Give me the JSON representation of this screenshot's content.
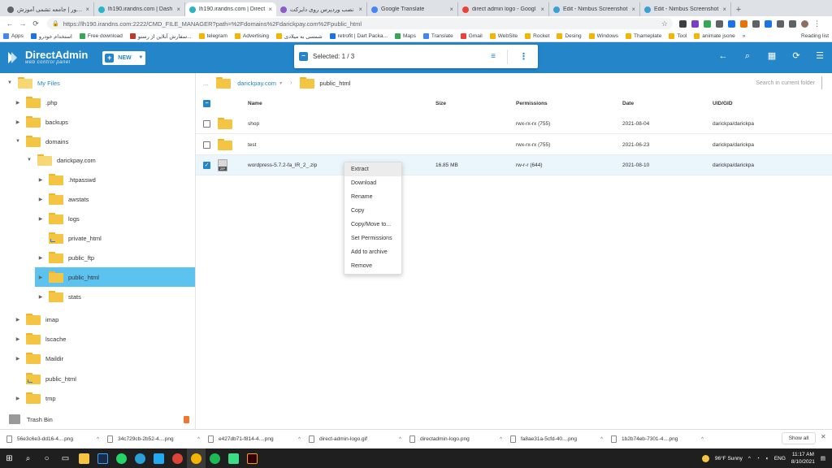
{
  "browser": {
    "tabs": [
      {
        "title": "المنتور | جامعه تشمی آموزش",
        "color": "#5f6368",
        "active": false
      },
      {
        "title": "lh190.irandns.com | Dash",
        "color": "#2bb3c6",
        "active": false
      },
      {
        "title": "lh190.irandns.com | Direct",
        "color": "#2bb3c6",
        "active": true
      },
      {
        "title": "نصب وردپرس روی دایرکت",
        "color": "#8a5cc7",
        "active": false
      },
      {
        "title": "Google Translate",
        "color": "#4285f4",
        "active": false
      },
      {
        "title": "direct admin logo - Googl",
        "color": "#ea4335",
        "active": false
      },
      {
        "title": "Edit - Nimbus Screenshot",
        "color": "#3aa0d8",
        "active": false
      },
      {
        "title": "Edit - Nimbus Screenshot",
        "color": "#3aa0d8",
        "active": false
      }
    ],
    "url": "https://lh190.irandns.com:2222/CMD_FILE_MANAGER?path=%2Fdomains%2Fdarickpay.com%2Fpublic_html",
    "bookmarks": [
      {
        "label": "Apps",
        "color": "#4285f4"
      },
      {
        "label": "استخدام خودرو",
        "color": "#1a73e8"
      },
      {
        "label": "Free download",
        "color": "#34a853"
      },
      {
        "label": "سفارش آنلاین از رستو...",
        "color": "#c0392b"
      },
      {
        "label": "telegram",
        "color": "#f4b400"
      },
      {
        "label": "Advertising",
        "color": "#f4b400"
      },
      {
        "label": "شمسی به میلادی",
        "color": "#f4b400"
      },
      {
        "label": "retrofit | Dart Packa...",
        "color": "#1a73e8"
      },
      {
        "label": "Maps",
        "color": "#34a853"
      },
      {
        "label": "Translate",
        "color": "#4285f4"
      },
      {
        "label": "Gmail",
        "color": "#ea4335"
      },
      {
        "label": "WebSite",
        "color": "#f4b400"
      },
      {
        "label": "Rocket",
        "color": "#f4b400"
      },
      {
        "label": "Desing",
        "color": "#f4b400"
      },
      {
        "label": "Windows",
        "color": "#f4b400"
      },
      {
        "label": "Thameplate",
        "color": "#f4b400"
      },
      {
        "label": "Tool",
        "color": "#f4b400"
      },
      {
        "label": "animate jsone",
        "color": "#f4b400"
      }
    ],
    "reading_list": "Reading list"
  },
  "app": {
    "logo_title": "DirectAdmin",
    "logo_sub": "web control panel",
    "new_label": "NEW",
    "selected_label": "Selected: 1 / 3",
    "accent": "#2486c8"
  },
  "sidebar": {
    "items": [
      {
        "label": "My Files",
        "icon": "folder-open-icon"
      },
      {
        "label": ".php"
      },
      {
        "label": "backups"
      },
      {
        "label": "domains"
      },
      {
        "label": "darickpay.com"
      },
      {
        "label": ".htpasswd"
      },
      {
        "label": "awstats"
      },
      {
        "label": "logs"
      },
      {
        "label": "private_html"
      },
      {
        "label": "public_ftp"
      },
      {
        "label": "public_html"
      },
      {
        "label": "stats"
      },
      {
        "label": "imap"
      },
      {
        "label": "lscache"
      },
      {
        "label": "Maildir"
      },
      {
        "label": "public_html"
      },
      {
        "label": "tmp"
      }
    ],
    "trash_label": "Trash Bin"
  },
  "breadcrumb": {
    "dots": "...",
    "domain": "darickpay.com",
    "current": "public_html",
    "search_placeholder": "Search in current folder"
  },
  "table": {
    "headers": {
      "name": "Name",
      "size": "Size",
      "permissions": "Permissions",
      "date": "Date",
      "owner": "UID/GID"
    },
    "rows": [
      {
        "name": "shop",
        "size": "",
        "permissions": "rwx-rx-rx (755)",
        "date": "2021-08-04",
        "owner": "darickpa/darickpa"
      },
      {
        "name": "test",
        "size": "",
        "permissions": "rwx-rx-rx (755)",
        "date": "2021-06-23",
        "owner": "darickpa/darickpa"
      },
      {
        "name": "wordpress-5.7.2-fa_IR_2_.zip",
        "size": "16.85 MB",
        "permissions": "rw-r-r (644)",
        "date": "2021-08-10",
        "owner": "darickpa/darickpa"
      }
    ]
  },
  "context_menu": [
    "Extract",
    "Download",
    "Rename",
    "Copy",
    "Copy/Move to...",
    "Set Permissions",
    "Add to archive",
    "Remove"
  ],
  "downloads": {
    "items": [
      "56e3c6e3-dd16-4....png",
      "34c729cb-2b52-4....png",
      "e427db71-f814-4....png",
      "direct-admin-logo.gif",
      "directadmin-logo.png",
      "fa8ae31a-5cfd-40....png",
      "1b2b74eb-7301-4....png"
    ],
    "show_all": "Show all"
  },
  "taskbar": {
    "weather": "96°F Sunny",
    "time": "11:17 AM",
    "date": "8/10/2021",
    "lang": "ENG"
  }
}
